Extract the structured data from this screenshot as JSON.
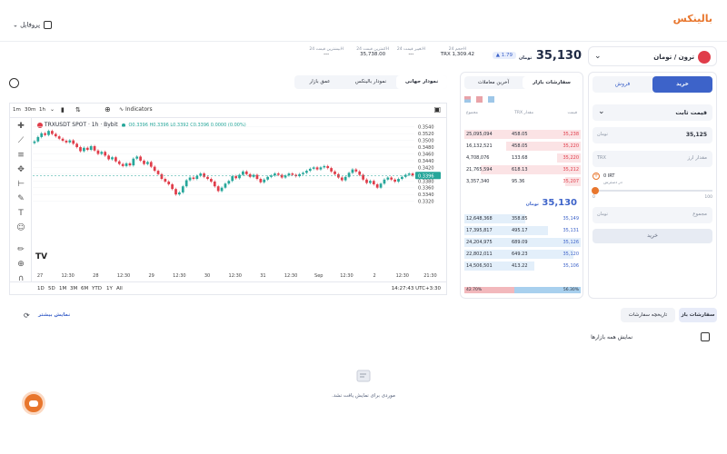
{
  "brand": "بالینکس",
  "profile_label": "پروفایل",
  "market": {
    "pair_label": "ترون / تومان",
    "price": "35,130",
    "change": "1.79",
    "stats": [
      {
        "label": "حجم 24H",
        "value": "TRX 1,309.42"
      },
      {
        "label": "تغییر قیمت 24H",
        "value": "---"
      },
      {
        "label": "کمترین قیمت 24H",
        "value": "35,738.00"
      },
      {
        "label": "بیشترین قیمت 24H",
        "value": "---"
      }
    ]
  },
  "trade": {
    "buy_tab": "خرید",
    "sell_tab": "فروش",
    "order_type": "قیمت ثابت",
    "price_value": "35,125",
    "amount_placeholder": "مقدار ارز",
    "available_label": "در دسترس",
    "available_value": "0 IRT",
    "slider_min": "0",
    "slider_max": "100",
    "total_placeholder": "مجموع",
    "submit": "خرید"
  },
  "orderbook": {
    "tabs": [
      "سفارشات بازار",
      "آخرین معاملات"
    ],
    "headers": [
      "قیمت",
      "مقدار TRX",
      "مجموع"
    ],
    "asks": [
      {
        "price": "35,238",
        "amount": "458.05",
        "total": "25,095,094"
      },
      {
        "price": "35,220",
        "amount": "458.05",
        "total": "16,132,521"
      },
      {
        "price": "35,220",
        "amount": "133.68",
        "total": "4,708,076"
      },
      {
        "price": "35,212",
        "amount": "618.13",
        "total": "21,765,594"
      },
      {
        "price": "35,207",
        "amount": "95.36",
        "total": "3,357,340"
      }
    ],
    "mid_price": "35,130",
    "bids": [
      {
        "price": "35,149",
        "amount": "358.85",
        "total": "12,648,368"
      },
      {
        "price": "35,131",
        "amount": "495.17",
        "total": "17,395,817"
      },
      {
        "price": "35,126",
        "amount": "689.09",
        "total": "24,204,975"
      },
      {
        "price": "35,120",
        "amount": "649.23",
        "total": "22,802,011"
      },
      {
        "price": "35,106",
        "amount": "413.22",
        "total": "14,506,501"
      }
    ],
    "ratio_sell": "42.70%",
    "ratio_buy": "56.30%"
  },
  "chart_tabs": [
    "نمودار جهانی",
    "نمودار بالینکس",
    "عمق بازار"
  ],
  "toolbar": {
    "intervals": [
      "1m",
      "30m",
      "1h"
    ],
    "indicators": "Indicators"
  },
  "chart": {
    "symbol": "TRXUSDT SPOT · 1h · Bybit",
    "ohlc": "O0.3396 H0.3396 L0.3392 C0.3396 0.0000 (0.00%)",
    "current_price": "0.3396",
    "range_buttons": [
      "1D",
      "5D",
      "1M",
      "3M",
      "6M",
      "YTD",
      "1Y",
      "All"
    ],
    "clock": "14:27:43 UTC+3:30",
    "tv_logo": "TV"
  },
  "chart_data": {
    "type": "candlestick",
    "ylim": [
      0.312,
      0.355
    ],
    "y_ticks": [
      "0.3540",
      "0.3520",
      "0.3500",
      "0.3480",
      "0.3460",
      "0.3440",
      "0.3420",
      "0.3400",
      "0.3380",
      "0.3360",
      "0.3340",
      "0.3320"
    ],
    "x_ticks": [
      "27",
      "12:30",
      "28",
      "12:30",
      "29",
      "12:30",
      "30",
      "12:30",
      "31",
      "12:30",
      "Sep",
      "12:30",
      "2",
      "12:30",
      "21:30"
    ],
    "closes": [
      0.3497,
      0.351,
      0.3521,
      0.3516,
      0.3528,
      0.3519,
      0.3512,
      0.3505,
      0.3499,
      0.3494,
      0.35,
      0.349,
      0.348,
      0.3468,
      0.3478,
      0.3472,
      0.3483,
      0.347,
      0.346,
      0.3466,
      0.3455,
      0.3444,
      0.345,
      0.3438,
      0.343,
      0.3424,
      0.3432,
      0.3426,
      0.3446,
      0.3452,
      0.344,
      0.343,
      0.3436,
      0.3422,
      0.341,
      0.34,
      0.3386,
      0.3378,
      0.337,
      0.3356,
      0.334,
      0.3346,
      0.3364,
      0.3382,
      0.339,
      0.3386,
      0.3395,
      0.3402,
      0.3392,
      0.3386,
      0.3378,
      0.3364,
      0.335,
      0.336,
      0.3372,
      0.338,
      0.3394,
      0.3388,
      0.3398,
      0.3408,
      0.34,
      0.3392,
      0.3398,
      0.3386,
      0.3376,
      0.3384,
      0.3392,
      0.3396,
      0.3402,
      0.3398,
      0.339,
      0.3396,
      0.3402,
      0.3398,
      0.3394,
      0.34,
      0.3404,
      0.341,
      0.3416,
      0.342,
      0.3414,
      0.342,
      0.3424,
      0.3418,
      0.3408,
      0.34,
      0.339,
      0.3382,
      0.3392,
      0.3404,
      0.3414,
      0.3408,
      0.3398,
      0.3384,
      0.3374,
      0.338,
      0.337,
      0.336,
      0.3372,
      0.3384,
      0.339,
      0.3384,
      0.3378,
      0.3386,
      0.3392,
      0.3398,
      0.3402,
      0.3396
    ]
  },
  "orders": {
    "tabs": [
      "سفارشات باز",
      "تاریخچه سفارشات"
    ],
    "show_all": "نمایش همه بازارها",
    "show_more": "نمایش بیشتر",
    "empty": "موردی برای نمایش یافت نشد."
  },
  "colors": {
    "accent": "#3d63c9",
    "up": "#26a69a",
    "down": "#e03d4a",
    "brand": "#e8762d"
  }
}
